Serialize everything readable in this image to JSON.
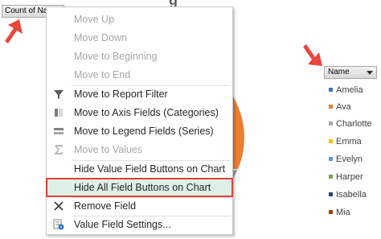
{
  "field_button": {
    "label": "Count of Na"
  },
  "chart_title_fragment": "g",
  "context_menu": {
    "items": [
      {
        "label": "Move Up",
        "disabled": true,
        "icon": ""
      },
      {
        "label": "Move Down",
        "disabled": true,
        "icon": ""
      },
      {
        "label": "Move to Beginning",
        "disabled": true,
        "icon": ""
      },
      {
        "label": "Move to End",
        "disabled": true,
        "icon": ""
      },
      {
        "label": "Move to Report Filter",
        "disabled": false,
        "icon": "filter-icon"
      },
      {
        "label": "Move to Axis Fields (Categories)",
        "disabled": false,
        "icon": "axis-fields-icon"
      },
      {
        "label": "Move to Legend Fields (Series)",
        "disabled": false,
        "icon": "legend-fields-icon"
      },
      {
        "label": "Move to Values",
        "disabled": true,
        "icon": "sigma-icon"
      },
      {
        "label": "Hide Value Field Buttons on Chart",
        "disabled": false,
        "icon": ""
      },
      {
        "label": "Hide All Field Buttons on Chart",
        "disabled": false,
        "icon": "",
        "highlighted": true
      },
      {
        "label": "Remove Field",
        "disabled": false,
        "icon": "remove-x-icon"
      },
      {
        "label": "Value Field Settings...",
        "disabled": false,
        "icon": "field-settings-icon"
      }
    ]
  },
  "legend": {
    "header": "Name",
    "entries": [
      {
        "name": "Amelia",
        "color": "#4472c4"
      },
      {
        "name": "Ava",
        "color": "#ed7d31"
      },
      {
        "name": "Charlotte",
        "color": "#a5a5a5"
      },
      {
        "name": "Emma",
        "color": "#ffc000"
      },
      {
        "name": "Evelyn",
        "color": "#5b9bd5"
      },
      {
        "name": "Harper",
        "color": "#70ad47"
      },
      {
        "name": "Isabella",
        "color": "#264478"
      },
      {
        "name": "Mia",
        "color": "#9e480e"
      }
    ]
  },
  "colors": {
    "highlight_border": "#e0413c",
    "highlight_fill": "#dcf0e6",
    "annotation_arrow": "#e8473d"
  }
}
